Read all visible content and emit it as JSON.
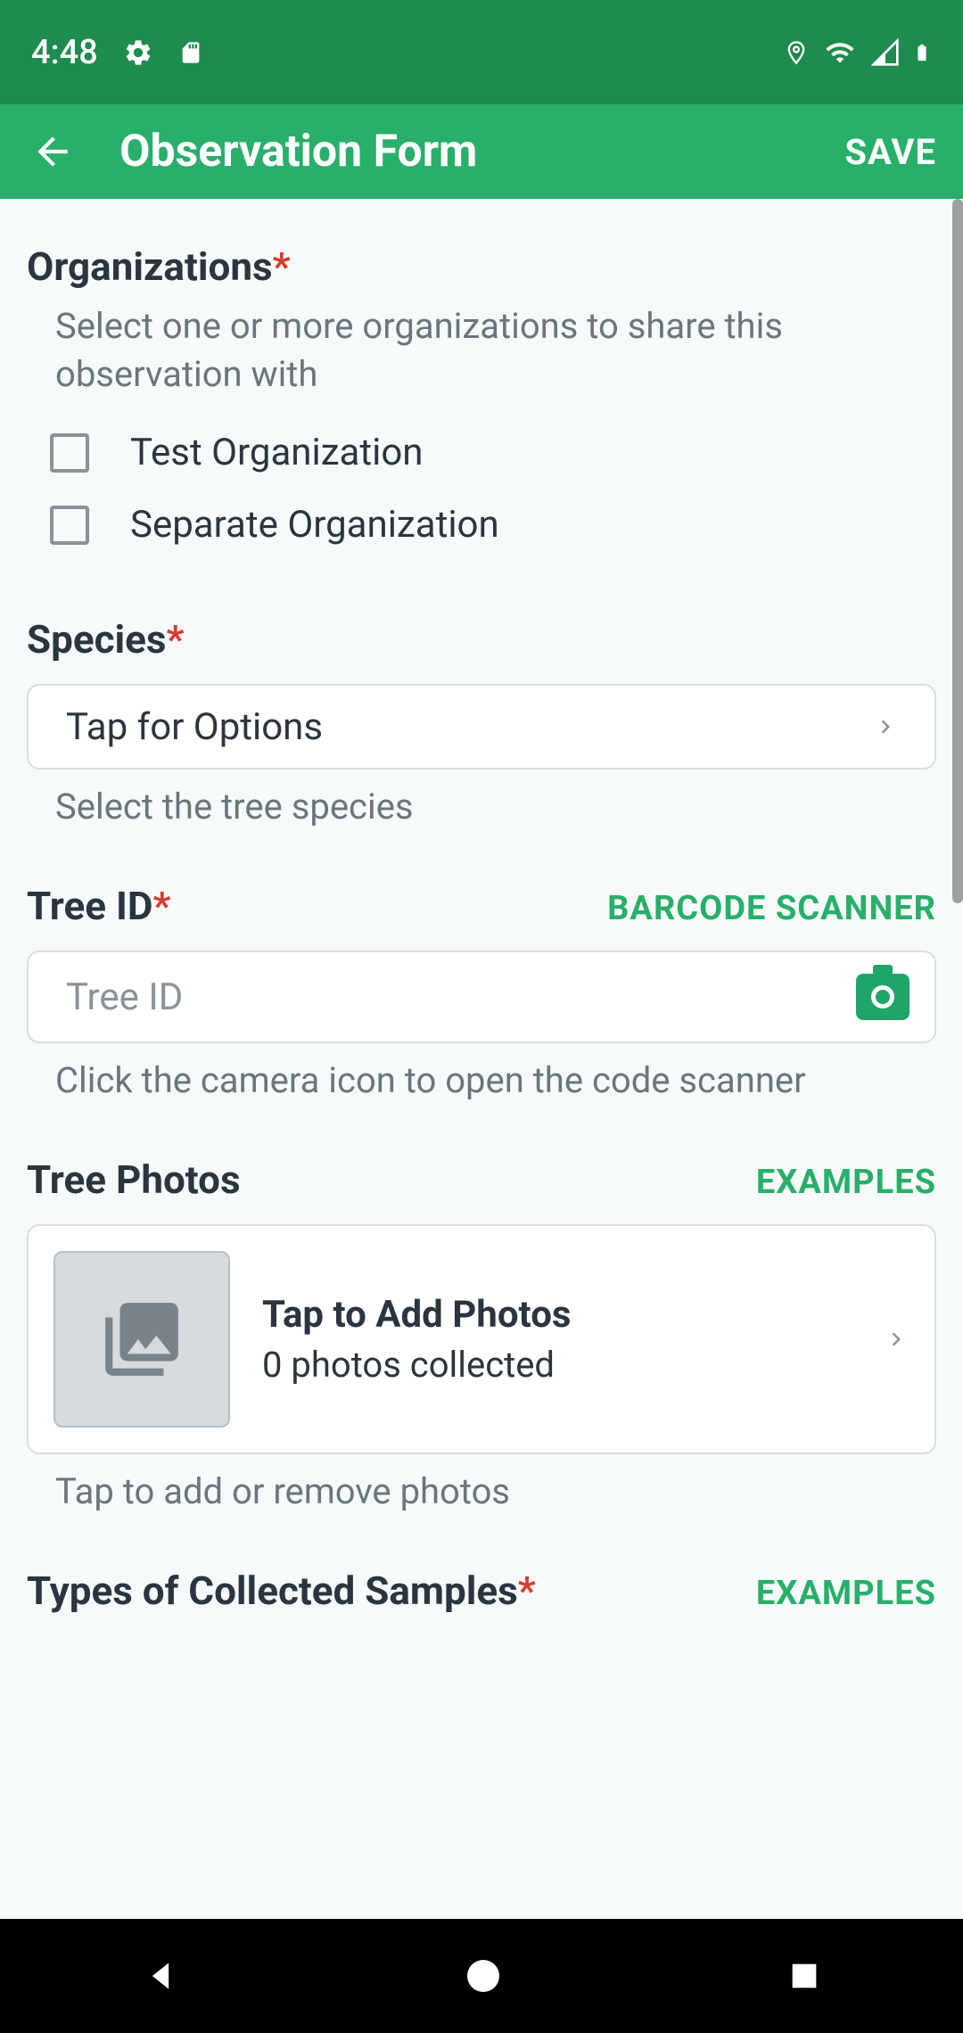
{
  "status": {
    "time": "4:48"
  },
  "appbar": {
    "title": "Observation Form",
    "save": "SAVE"
  },
  "org": {
    "title": "Organizations",
    "hint": "Select one or more organizations to share this observation with",
    "items": [
      {
        "label": "Test Organization"
      },
      {
        "label": "Separate Organization"
      }
    ]
  },
  "species": {
    "title": "Species",
    "placeholder": "Tap for Options",
    "hint": "Select the tree species"
  },
  "treeid": {
    "title": "Tree ID",
    "action": "BARCODE SCANNER",
    "placeholder": "Tree ID",
    "hint": "Click the camera icon to open the code scanner"
  },
  "photos": {
    "title": "Tree Photos",
    "action": "EXAMPLES",
    "add_title": "Tap to Add Photos",
    "count_text": "0 photos collected",
    "hint": "Tap to add or remove photos"
  },
  "samples": {
    "title": "Types of Collected Samples",
    "action": "EXAMPLES"
  }
}
